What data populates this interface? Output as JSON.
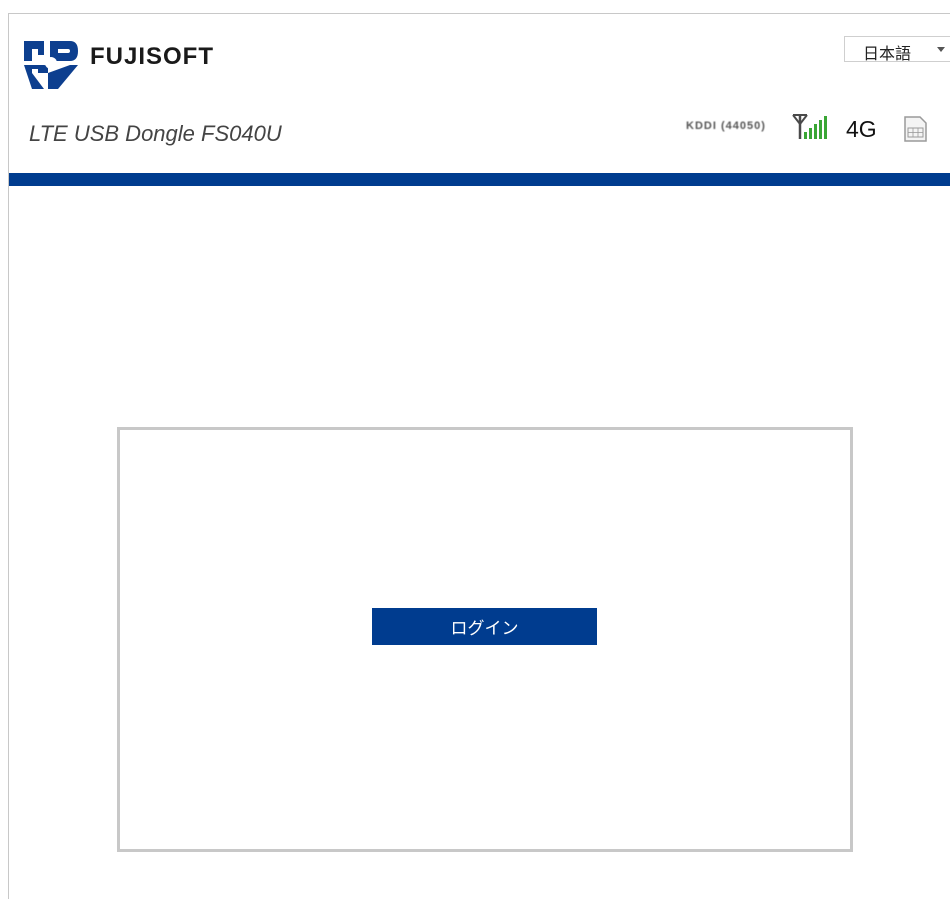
{
  "header": {
    "brand": "FUJISOFT",
    "product_name": "LTE USB Dongle FS040U",
    "language": {
      "selected": "日本語"
    }
  },
  "status": {
    "operator": "KDDI (44050)",
    "network_type": "4G",
    "signal_bars": 5,
    "signal_color": "#3aa635",
    "icons": [
      "antenna-icon",
      "signal-bars-icon",
      "sim-card-icon"
    ]
  },
  "colors": {
    "brand_blue": "#003c8f",
    "logo_blue": "#0d3f8f"
  },
  "login": {
    "button_label": "ログイン"
  }
}
